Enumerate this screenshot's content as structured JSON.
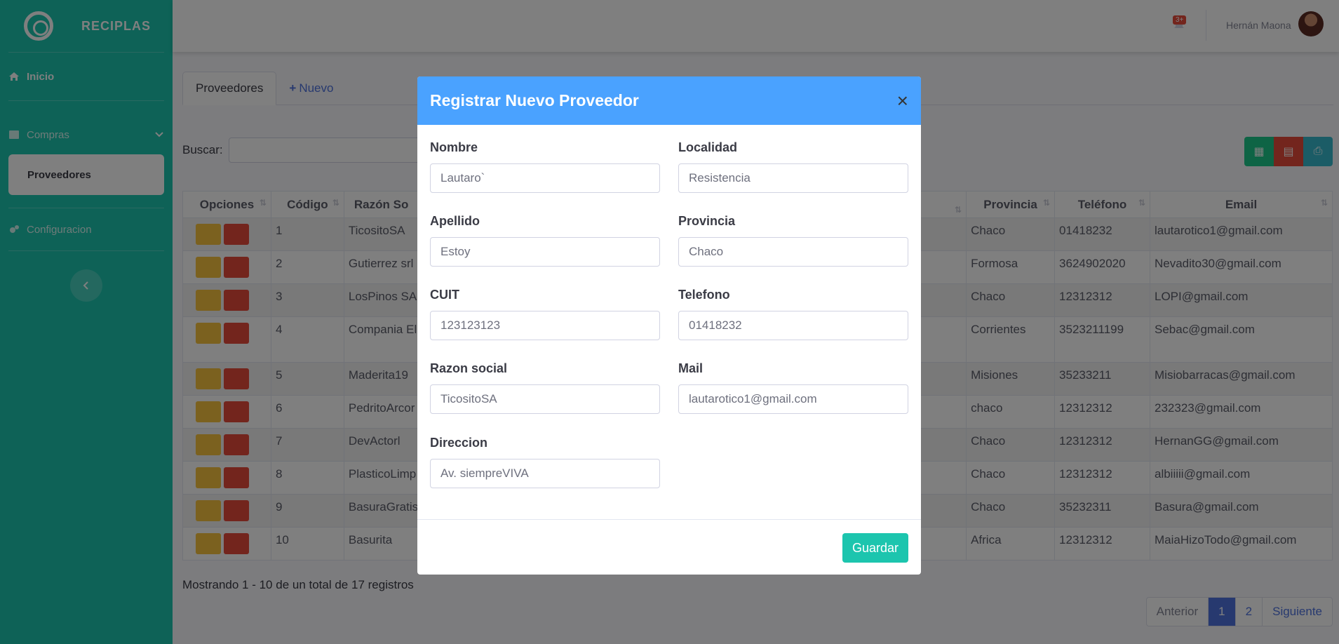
{
  "brand": {
    "name": "RECIPLAS"
  },
  "sidebar": {
    "inicio": "Inicio",
    "compras": "Compras",
    "proveedores": "Proveedores",
    "configuracion": "Configuracion"
  },
  "topbar": {
    "alerts_badge": "3+",
    "user_name": "Hernán Maona"
  },
  "tabs": {
    "proveedores": "Proveedores",
    "nuevo": "Nuevo"
  },
  "search": {
    "label": "Buscar:"
  },
  "table": {
    "headers": [
      "Opciones",
      "Código",
      "Razón So",
      "Provincia",
      "Teléfono",
      "Email"
    ],
    "rows": [
      {
        "codigo": "1",
        "razon": "TicositoSA",
        "provincia": "Chaco",
        "telefono": "01418232",
        "email": "lautarotico1@gmail.com"
      },
      {
        "codigo": "2",
        "razon": "Gutierrez srl",
        "provincia": "Formosa",
        "telefono": "3624902020",
        "email": "Nevadito30@gmail.com"
      },
      {
        "codigo": "3",
        "razon": "LosPinos SA",
        "provincia": "Chaco",
        "telefono": "12312312",
        "email": "LOPI@gmail.com"
      },
      {
        "codigo": "4",
        "razon": "Compania El Goyano",
        "provincia": "Corrientes",
        "telefono": "3523211199",
        "email": "Sebac@gmail.com"
      },
      {
        "codigo": "5",
        "razon": "Maderita19",
        "provincia": "Misiones",
        "telefono": "35233211",
        "email": "Misiobarracas@gmail.com"
      },
      {
        "codigo": "6",
        "razon": "PedritoArcor",
        "provincia": "chaco",
        "telefono": "12312312",
        "email": "232323@gmail.com"
      },
      {
        "codigo": "7",
        "razon": "DevActorl",
        "provincia": "Chaco",
        "telefono": "12312312",
        "email": "HernanGG@gmail.com"
      },
      {
        "codigo": "8",
        "razon": "PlasticoLimp",
        "provincia": "Chaco",
        "telefono": "12312312",
        "email": "albiiiii@gmail.com"
      },
      {
        "codigo": "9",
        "razon": "BasuraGratis",
        "provincia": "Chaco",
        "telefono": "35232311",
        "email": "Basura@gmail.com"
      },
      {
        "codigo": "10",
        "razon": "Basurita",
        "provincia": "Africa",
        "telefono": "12312312",
        "email": "MaiaHizoTodo@gmail.com"
      }
    ]
  },
  "footer": {
    "info": "Mostrando 1 - 10 de un total de 17 registros"
  },
  "pager": {
    "prev": "Anterior",
    "p1": "1",
    "p2": "2",
    "next": "Siguiente"
  },
  "modal": {
    "title": "Registrar Nuevo Proveedor",
    "close": "×",
    "fields": {
      "nombre": {
        "label": "Nombre",
        "value": "Lautaro`"
      },
      "localidad": {
        "label": "Localidad",
        "value": "Resistencia"
      },
      "apellido": {
        "label": "Apellido",
        "value": "Estoy"
      },
      "provincia": {
        "label": "Provincia",
        "value": "Chaco"
      },
      "cuit": {
        "label": "CUIT",
        "value": "123123123"
      },
      "telefono": {
        "label": "Telefono",
        "value": "01418232"
      },
      "razon": {
        "label": "Razon social",
        "value": "TicositoSA"
      },
      "mail": {
        "label": "Mail",
        "value": "lautarotico1@gmail.com"
      },
      "direccion": {
        "label": "Direccion",
        "value": "Av. siempreVIVA"
      }
    },
    "save": "Guardar"
  }
}
